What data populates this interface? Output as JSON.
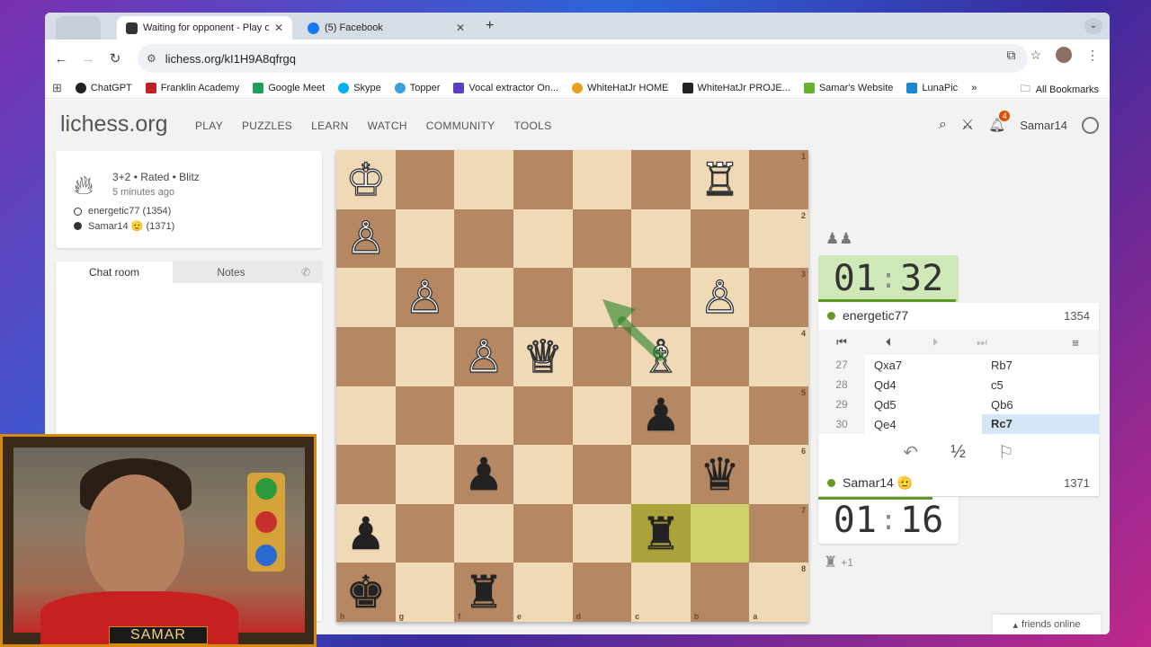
{
  "browser": {
    "tabs": [
      {
        "title": "Waiting for opponent - Play o",
        "active": true
      },
      {
        "title": "(5) Facebook",
        "active": false
      }
    ],
    "url": "lichess.org/kI1H9A8qfrgq",
    "bookmarks": [
      "ChatGPT",
      "Franklin Academy",
      "Google Meet",
      "Skype",
      "Topper",
      "Vocal extractor On...",
      "WhiteHatJr HOME",
      "WhiteHatJr PROJE...",
      "Samar's Website",
      "LunaPic"
    ],
    "more_bookmarks": "»",
    "all_bookmarks": "All Bookmarks"
  },
  "site": {
    "logo": "lichess.org",
    "nav": [
      "PLAY",
      "PUZZLES",
      "LEARN",
      "WATCH",
      "COMMUNITY",
      "TOOLS"
    ],
    "notification_count": "4",
    "username": "Samar14"
  },
  "game": {
    "type_line": "3+2 • Rated • Blitz",
    "time_ago": "5 minutes ago",
    "player_white": "energetic77 (1354)",
    "player_black": "Samar14 🫡 (1371)"
  },
  "chat": {
    "tab_chat": "Chat room",
    "tab_notes": "Notes"
  },
  "board": {
    "ranks": [
      "1",
      "2",
      "3",
      "4",
      "5",
      "6",
      "7",
      "8"
    ],
    "files": [
      "h",
      "g",
      "f",
      "e",
      "d",
      "c",
      "b",
      "a"
    ],
    "rows": [
      [
        "wK",
        "",
        "",
        "",
        "",
        "",
        "wR",
        ""
      ],
      [
        "wP",
        "",
        "",
        "",
        "",
        "",
        "",
        ""
      ],
      [
        "",
        "wP",
        "",
        "",
        "",
        "",
        "wP",
        ""
      ],
      [
        "",
        "",
        "wP",
        "wQ",
        "",
        "wB",
        "",
        ""
      ],
      [
        "",
        "",
        "",
        "",
        "",
        "bP",
        "",
        ""
      ],
      [
        "",
        "",
        "bP",
        "",
        "",
        "",
        "bQ",
        ""
      ],
      [
        "bP",
        "",
        "",
        "",
        "",
        "bR",
        "",
        ""
      ],
      [
        "bK",
        "",
        "bR",
        "",
        "",
        "",
        "",
        ""
      ]
    ]
  },
  "clocks": {
    "top": {
      "min": "01",
      "sec": "32"
    },
    "bottom": {
      "min": "01",
      "sec": "16"
    }
  },
  "players": {
    "top": {
      "name": "energetic77",
      "rating": "1354"
    },
    "bottom": {
      "name": "Samar14 🫡",
      "rating": "1371"
    }
  },
  "moves": [
    {
      "no": "27",
      "white": "Qxa7",
      "black": "Rb7"
    },
    {
      "no": "28",
      "white": "Qd4",
      "black": "c5"
    },
    {
      "no": "29",
      "white": "Qd5",
      "black": "Qb6"
    },
    {
      "no": "30",
      "white": "Qe4",
      "black": "Rc7"
    }
  ],
  "actions": {
    "takeback": "↶",
    "draw": "½",
    "resign": "⚐"
  },
  "material_bottom": "+1",
  "friends": "friends online",
  "webcam": {
    "label": "SAMAR"
  }
}
